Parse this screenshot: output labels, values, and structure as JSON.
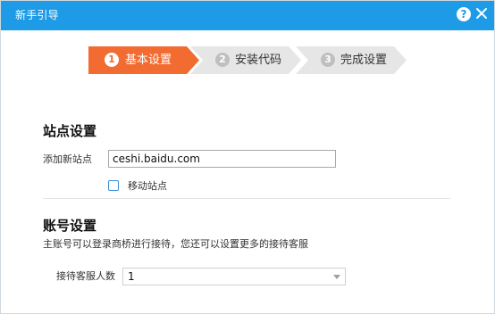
{
  "window": {
    "title": "新手引导",
    "help_label": "?",
    "colors": {
      "titlebar": "#1e9be6",
      "step_active": "#f26b30",
      "step_inactive": "#e6e6e6"
    }
  },
  "stepper": {
    "steps": [
      {
        "number": "1",
        "label": "基本设置",
        "active": true
      },
      {
        "number": "2",
        "label": "安装代码",
        "active": false
      },
      {
        "number": "3",
        "label": "完成设置",
        "active": false
      }
    ]
  },
  "site_settings": {
    "heading": "站点设置",
    "add_site_label": "添加新站点",
    "add_site_value": "ceshi.baidu.com",
    "mobile_site_label": "移动站点",
    "mobile_site_checked": false
  },
  "account_settings": {
    "heading": "账号设置",
    "description": "主账号可以登录商桥进行接待，您还可以设置更多的接待客服",
    "agent_count_label": "接待客服人数",
    "agent_count_value": "1"
  }
}
